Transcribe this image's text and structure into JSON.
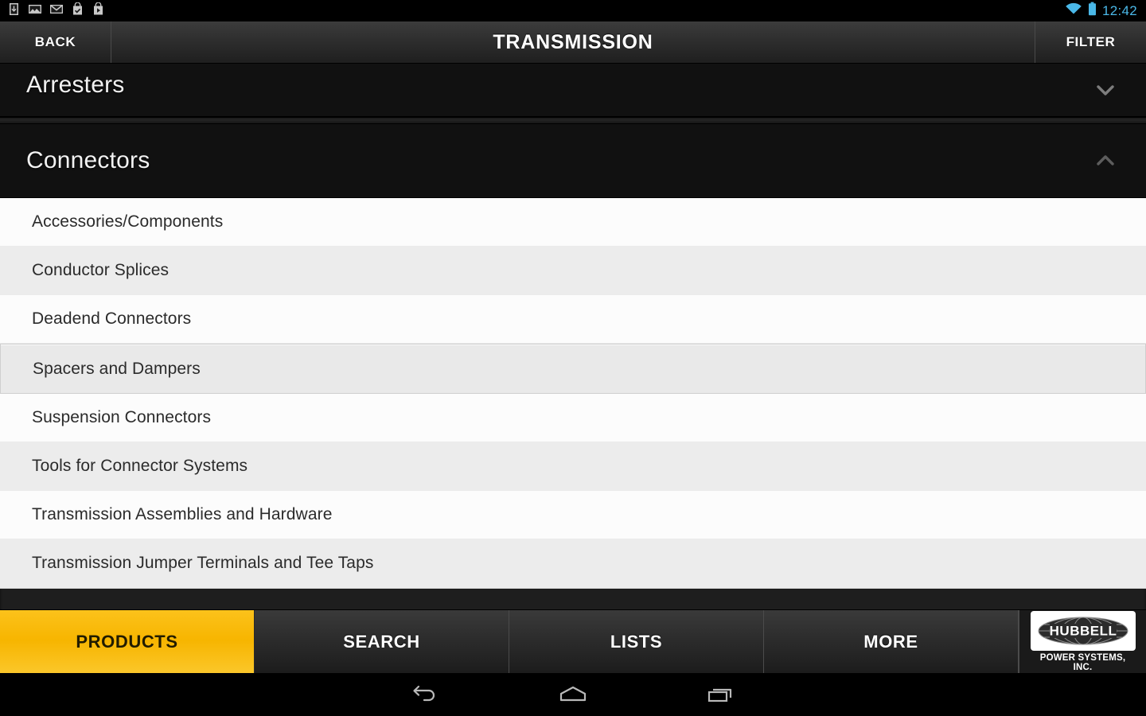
{
  "statusbar": {
    "notification_icons": [
      "download-icon",
      "gallery-image-icon",
      "gmail-icon",
      "play-store-check-icon",
      "play-store-media-icon"
    ],
    "wifi_icon": "wifi-icon",
    "battery_icon": "battery-icon",
    "time": "12:42",
    "accent_color": "#4ab8e8"
  },
  "titlebar": {
    "back_label": "BACK",
    "title": "TRANSMISSION",
    "filter_label": "FILTER"
  },
  "groups": [
    {
      "label": "Arresters",
      "state": "collapsed",
      "chevron": "chevron-down-icon"
    },
    {
      "label": "Connectors",
      "state": "expanded",
      "chevron": "chevron-up-icon"
    }
  ],
  "list": {
    "items": [
      {
        "label": "Accessories/Components",
        "selected": false
      },
      {
        "label": "Conductor Splices",
        "selected": false
      },
      {
        "label": "Deadend Connectors",
        "selected": false
      },
      {
        "label": "Spacers and Dampers",
        "selected": true
      },
      {
        "label": "Suspension Connectors",
        "selected": false
      },
      {
        "label": "Tools for Connector Systems",
        "selected": false
      },
      {
        "label": "Transmission Assemblies and Hardware",
        "selected": false
      },
      {
        "label": "Transmission Jumper Terminals and Tee Taps",
        "selected": false
      }
    ]
  },
  "tabbar": {
    "active_color": "#f7b500",
    "tabs": [
      {
        "label": "PRODUCTS",
        "active": true
      },
      {
        "label": "SEARCH",
        "active": false
      },
      {
        "label": "LISTS",
        "active": false
      },
      {
        "label": "MORE",
        "active": false
      }
    ],
    "logo": {
      "name": "HUBBELL",
      "subtitle": "POWER SYSTEMS, INC."
    }
  },
  "navbar": {
    "buttons": [
      "back-nav-icon",
      "home-nav-icon",
      "recents-nav-icon"
    ]
  }
}
